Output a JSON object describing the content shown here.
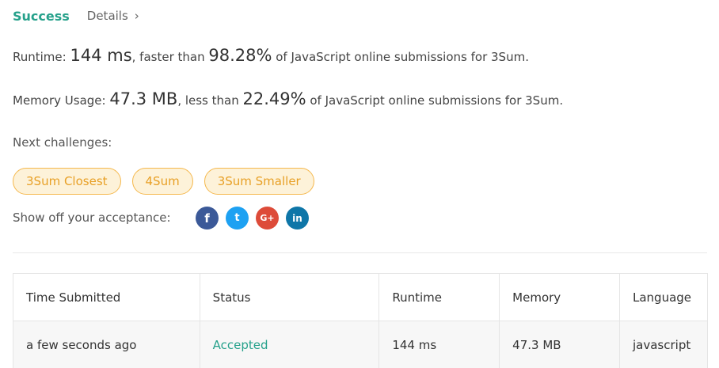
{
  "header": {
    "status": "Success",
    "details_label": "Details",
    "details_chevron": "›"
  },
  "runtime": {
    "prefix": "Runtime: ",
    "value": "144 ms",
    "mid": ", faster than ",
    "percent": "98.28%",
    "suffix": " of JavaScript online submissions for 3Sum."
  },
  "memory": {
    "prefix": "Memory Usage: ",
    "value": "47.3 MB",
    "mid": ", less than ",
    "percent": "22.49%",
    "suffix": " of JavaScript online submissions for 3Sum."
  },
  "next_challenges": {
    "label": "Next challenges:",
    "items": [
      "3Sum Closest",
      "4Sum",
      "3Sum Smaller"
    ]
  },
  "share": {
    "label": "Show off your acceptance:",
    "icons": [
      {
        "name": "facebook-icon",
        "glyph": "f"
      },
      {
        "name": "twitter-icon",
        "glyph": "t"
      },
      {
        "name": "google-plus-icon",
        "glyph": "G+"
      },
      {
        "name": "linkedin-icon",
        "glyph": "in"
      }
    ]
  },
  "submissions": {
    "columns": [
      "Time Submitted",
      "Status",
      "Runtime",
      "Memory",
      "Language"
    ],
    "rows": [
      {
        "time": "a few seconds ago",
        "status": "Accepted",
        "runtime": "144 ms",
        "memory": "47.3 MB",
        "language": "javascript"
      }
    ]
  },
  "colors": {
    "success": "#26a18b",
    "chip_border": "#f5b84d",
    "chip_bg": "#fdf2d9",
    "chip_text": "#e8a026"
  }
}
